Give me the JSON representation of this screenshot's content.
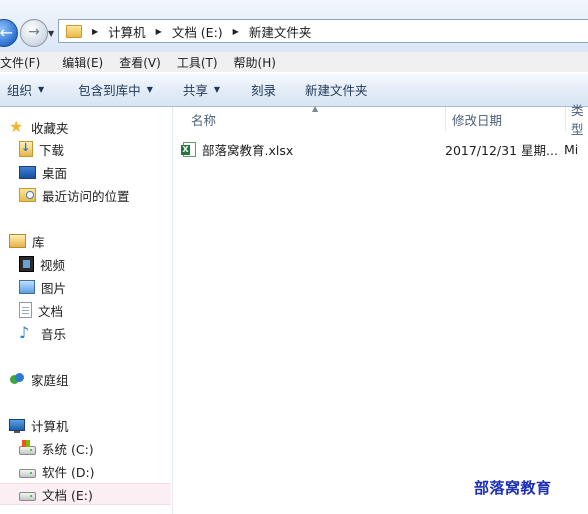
{
  "address": {
    "path": [
      "计算机",
      "文档 (E:)",
      "新建文件夹"
    ]
  },
  "menubar": {
    "items": [
      "文件(F)",
      "编辑(E)",
      "查看(V)",
      "工具(T)",
      "帮助(H)"
    ]
  },
  "commandbar": {
    "organize": "组织",
    "include_library": "包含到库中",
    "share": "共享",
    "burn": "刻录",
    "new_folder": "新建文件夹"
  },
  "navpane": {
    "favorites": "收藏夹",
    "downloads": "下载",
    "desktop": "桌面",
    "recent": "最近访问的位置",
    "libraries": "库",
    "videos": "视频",
    "pictures": "图片",
    "documents": "文档",
    "music": "音乐",
    "homegroup": "家庭组",
    "computer": "计算机",
    "drive_c": "系统 (C:)",
    "drive_d": "软件 (D:)",
    "drive_e": "文档 (E:)"
  },
  "columns": {
    "name": "名称",
    "date": "修改日期",
    "type": "类型"
  },
  "files": [
    {
      "name": "部落窝教育.xlsx",
      "date": "2017/12/31 星期...",
      "type": "Mi"
    }
  ],
  "watermark": "部落窝教育"
}
